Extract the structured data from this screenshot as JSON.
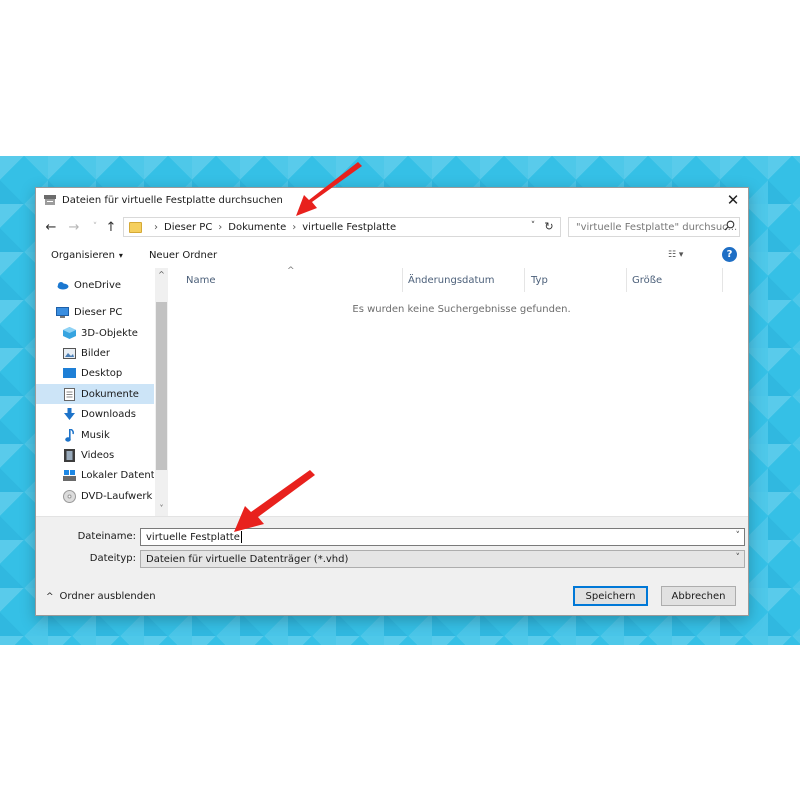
{
  "dialog": {
    "title": "Dateien für virtuelle Festplatte durchsuchen",
    "close_glyph": "✕"
  },
  "address": {
    "back_glyph": "←",
    "forward_glyph": "→",
    "recent_glyph": "˅",
    "up_glyph": "↑",
    "crumbs": [
      "Dieser PC",
      "Dokumente",
      "virtuelle Festplatte"
    ],
    "separator": "›",
    "dropdown_glyph": "˅",
    "refresh_glyph": "↻"
  },
  "search": {
    "placeholder": "\"virtuelle Festplatte\" durchsuc...",
    "icon": "search-icon"
  },
  "toolbar": {
    "organize_label": "Organisieren",
    "new_folder_label": "Neuer Ordner",
    "caret": "▾",
    "view_glyph": "☷ ▾",
    "help_glyph": "?"
  },
  "nav": {
    "items": [
      {
        "label": "OneDrive",
        "icon": "onedrive-icon"
      },
      {
        "label": "Dieser PC",
        "icon": "pc-icon"
      },
      {
        "label": "3D-Objekte",
        "icon": "3d-objects-icon"
      },
      {
        "label": "Bilder",
        "icon": "pictures-icon"
      },
      {
        "label": "Desktop",
        "icon": "desktop-icon"
      },
      {
        "label": "Dokumente",
        "icon": "documents-icon",
        "selected": true
      },
      {
        "label": "Downloads",
        "icon": "downloads-icon"
      },
      {
        "label": "Musik",
        "icon": "music-icon"
      },
      {
        "label": "Videos",
        "icon": "videos-icon"
      },
      {
        "label": "Lokaler Datenträ",
        "icon": "drive-icon"
      },
      {
        "label": "DVD-Laufwerk (I",
        "icon": "dvd-icon"
      }
    ],
    "scroll_up": "^",
    "scroll_down": "˅"
  },
  "columns": {
    "name": "Name",
    "date": "Änderungsdatum",
    "type": "Typ",
    "size": "Größe",
    "sort_glyph": "^"
  },
  "empty_message": "Es wurden keine Suchergebnisse gefunden.",
  "form": {
    "filename_label": "Dateiname:",
    "filename_value": "virtuelle Festplatte",
    "filetype_label": "Dateityp:",
    "filetype_value": "Dateien für virtuelle Datenträger (*.vhd)",
    "dropdown_glyph": "˅"
  },
  "footer": {
    "hide_folders_label": "Ordner ausblenden",
    "hide_glyph": "^",
    "save_label": "Speichern",
    "cancel_label": "Abbrechen"
  },
  "colors": {
    "accent": "#0078d7",
    "annotation_arrow": "#e8211d",
    "selected_bg": "#cce4f7"
  }
}
